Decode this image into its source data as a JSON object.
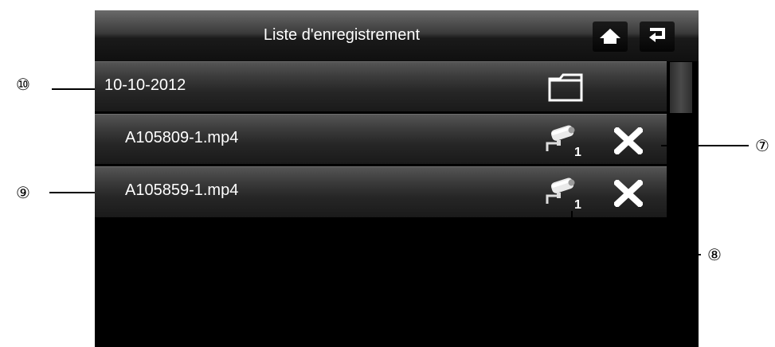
{
  "header": {
    "title": "Liste d'enregistrement",
    "home_icon": "home-icon",
    "back_icon": "return-icon"
  },
  "list": {
    "folder": {
      "label": "10-10-2012",
      "icon": "folder-icon"
    },
    "files": [
      {
        "name": "A105809-1.mp4",
        "camera_icon": "camera-icon",
        "camera_number": "1",
        "delete_icon": "delete-x-icon"
      },
      {
        "name": "A105859-1.mp4",
        "camera_icon": "camera-icon",
        "camera_number": "1",
        "delete_icon": "delete-x-icon"
      }
    ]
  },
  "callouts": {
    "c7": "⑦",
    "c8": "⑧",
    "c9": "⑨",
    "c10": "⑩"
  },
  "colors": {
    "screen_bg": "#000000",
    "text": "#ffffff",
    "icon": "#ffffff"
  }
}
